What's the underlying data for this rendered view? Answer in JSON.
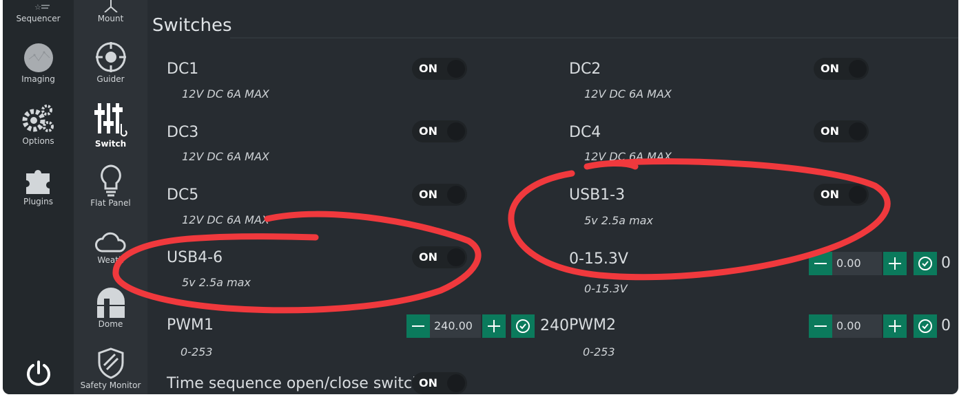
{
  "nav": {
    "primary": [
      {
        "label": "Sequencer",
        "icon": "sequencer-icon"
      },
      {
        "label": "Imaging",
        "icon": "imaging-icon"
      },
      {
        "label": "Options",
        "icon": "gears-icon"
      },
      {
        "label": "Plugins",
        "icon": "puzzle-icon"
      }
    ],
    "power_icon": "power-icon",
    "equipment": [
      {
        "label": "Mount",
        "icon": "mount-icon"
      },
      {
        "label": "Guider",
        "icon": "guider-icon"
      },
      {
        "label": "Switch",
        "icon": "switch-icon",
        "active": true
      },
      {
        "label": "Flat Panel",
        "icon": "lightbulb-icon"
      },
      {
        "label": "Weath",
        "icon": "cloud-icon"
      },
      {
        "label": "Dome",
        "icon": "dome-icon"
      },
      {
        "label": "Safety Monitor",
        "icon": "shield-icon"
      }
    ]
  },
  "page": {
    "title": "Switches"
  },
  "switches": [
    {
      "name": "DC1",
      "desc": "12V DC 6A MAX",
      "state": "ON"
    },
    {
      "name": "DC2",
      "desc": "12V DC 6A MAX",
      "state": "ON"
    },
    {
      "name": "DC3",
      "desc": "12V DC 6A MAX",
      "state": "ON"
    },
    {
      "name": "DC4",
      "desc": "12V DC 6A MAX",
      "state": "ON"
    },
    {
      "name": "DC5",
      "desc": "12V DC 6A MAX",
      "state": "ON"
    },
    {
      "name": "USB1-3",
      "desc": "5v 2.5a max",
      "state": "ON"
    },
    {
      "name": "USB4-6",
      "desc": "5v 2.5a max",
      "state": "ON"
    },
    {
      "name": "0-15.3V",
      "desc": "0-15.3V",
      "value": "0.00",
      "readout": "0"
    },
    {
      "name": "PWM1",
      "desc": "0-253",
      "value": "240.00",
      "readout": "240"
    },
    {
      "name": "PWM2",
      "desc": "0-253",
      "value": "0.00",
      "readout": "0"
    },
    {
      "name": "Time sequence open/close switch",
      "state": "ON"
    }
  ],
  "colors": {
    "accent": "#0b7a5c",
    "annotation": "#f0393d",
    "background": "#272c31"
  }
}
